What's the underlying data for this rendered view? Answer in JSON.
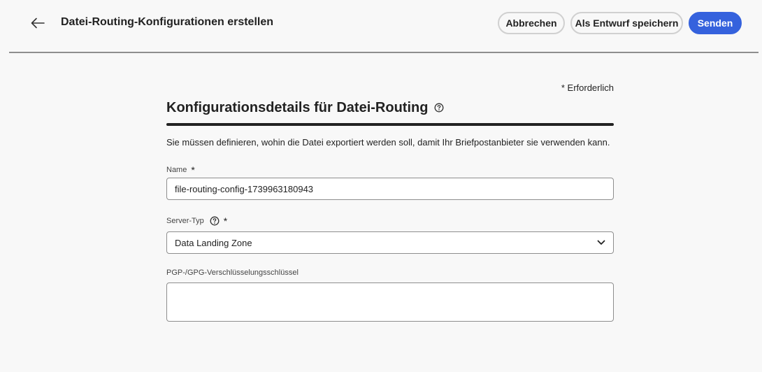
{
  "header": {
    "title": "Datei-Routing-Konfigurationen erstellen",
    "back_icon": "arrow-left-icon",
    "cancel_label": "Abbrechen",
    "save_draft_label": "Als Entwurf speichern",
    "submit_label": "Senden"
  },
  "form": {
    "required_note": "* Erforderlich",
    "section_title": "Konfigurationsdetails für Datei-Routing",
    "description": "Sie müssen definieren, wohin die Datei exportiert werden soll, damit Ihr Briefpostanbieter sie verwenden kann.",
    "name": {
      "label": "Name",
      "required_mark": "*",
      "value": "file-routing-config-1739963180943"
    },
    "server_type": {
      "label": "Server-Typ",
      "required_mark": "*",
      "selected": "Data Landing Zone"
    },
    "pgp_key": {
      "label": "PGP-/GPG-Verschlüsselungsschlüssel",
      "value": ""
    }
  },
  "colors": {
    "primary": "#3562dd",
    "background": "#f8f8f8",
    "text": "#222222"
  }
}
